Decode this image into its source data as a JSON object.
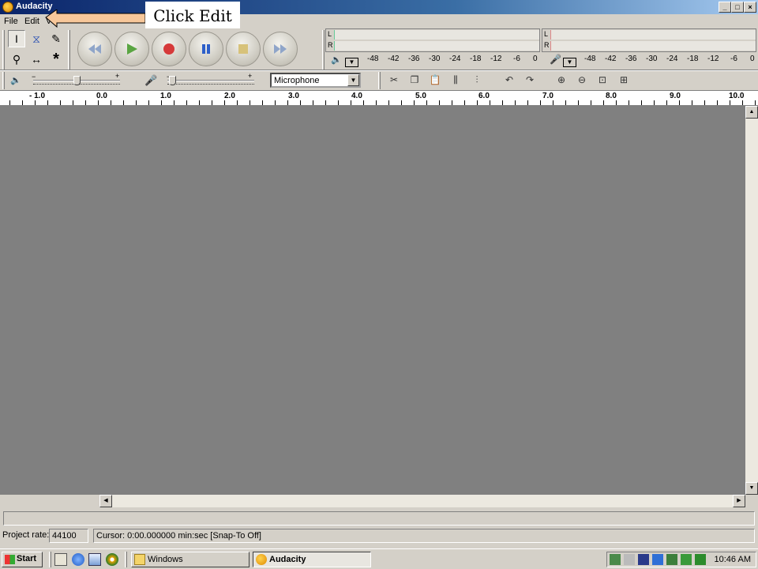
{
  "window": {
    "title": "Audacity"
  },
  "menu": {
    "items": [
      "File",
      "Edit",
      "View"
    ]
  },
  "annotation": {
    "text": "Click Edit"
  },
  "meters": {
    "left": "L",
    "right": "R",
    "scale": [
      "-48",
      "-42",
      "-36",
      "-30",
      "-24",
      "-18",
      "-12",
      "-6",
      "0"
    ]
  },
  "input_source": {
    "selected": "Microphone"
  },
  "ruler": {
    "labels": [
      "- 1.0",
      "0.0",
      "1.0",
      "2.0",
      "3.0",
      "4.0",
      "5.0",
      "6.0",
      "7.0",
      "8.0",
      "9.0",
      "10.0"
    ]
  },
  "status": {
    "project_rate_label": "Project rate:",
    "project_rate_value": "44100",
    "cursor_text": "Cursor: 0:00.000000 min:sec   [Snap-To Off]"
  },
  "taskbar": {
    "start_label": "Start",
    "tasks": [
      {
        "label": "Windows",
        "active": false
      },
      {
        "label": "Audacity",
        "active": true
      }
    ],
    "clock": "10:46 AM"
  },
  "colors": {
    "titlebar_start": "#0a246a",
    "track_bg": "#808080",
    "record_red": "#d63a3a",
    "play_green": "#5aa542",
    "pause_blue": "#2d5fc9"
  }
}
